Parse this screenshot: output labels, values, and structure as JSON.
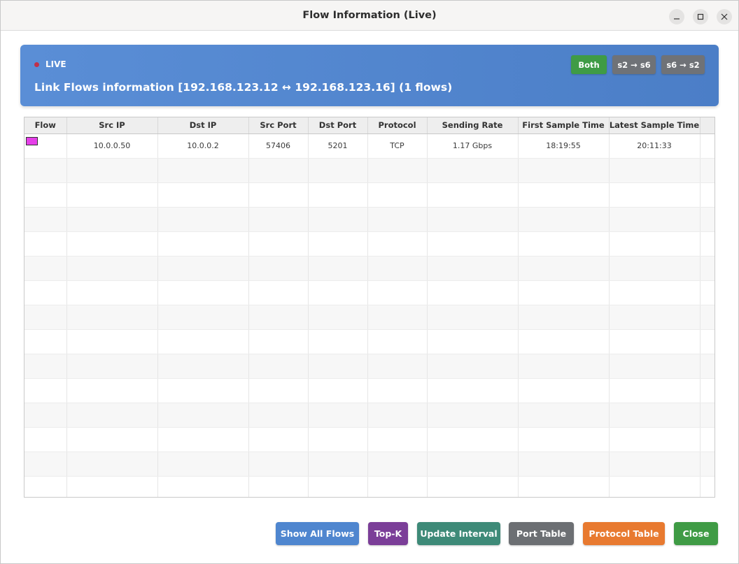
{
  "window": {
    "title": "Flow Information (Live)"
  },
  "header": {
    "live_label": "LIVE",
    "title": "Link Flows information [192.168.123.12 ↔ 192.168.123.16] (1 flows)",
    "direction_buttons": [
      "Both",
      "s2 → s6",
      "s6 → s2"
    ]
  },
  "table": {
    "columns": [
      "Flow",
      "Src IP",
      "Dst IP",
      "Src Port",
      "Dst Port",
      "Protocol",
      "Sending Rate",
      "First Sample Time",
      "Latest Sample Time"
    ],
    "rows": [
      {
        "flow_color": "#e53fe8",
        "src_ip": "10.0.0.50",
        "dst_ip": "10.0.0.2",
        "src_port": "57406",
        "dst_port": "5201",
        "protocol": "TCP",
        "sending_rate": "1.17 Gbps",
        "first_sample_time": "18:19:55",
        "latest_sample_time": "20:11:33"
      }
    ]
  },
  "footer": {
    "show_all_flows": "Show All Flows",
    "top_k": "Top-K",
    "update_interval": "Update Interval",
    "port_table": "Port Table",
    "protocol_table": "Protocol Table",
    "close": "Close"
  },
  "icons": {
    "minimize": "minimize-icon",
    "maximize": "maximize-icon",
    "close": "close-icon"
  },
  "colors": {
    "header_bg": "#5a8ed6",
    "live_dot": "#c0304a",
    "both_button": "#3f9b45",
    "direction_button": "#6f7277"
  }
}
